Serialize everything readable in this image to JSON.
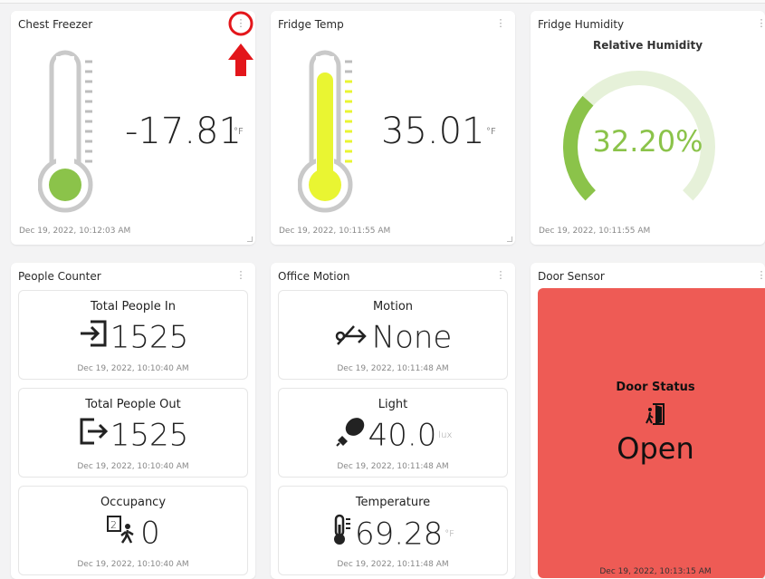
{
  "widgets": {
    "chest_freezer": {
      "title": "Chest Freezer",
      "value": "-17.81",
      "unit": "°F",
      "timestamp": "Dec 19, 2022, 10:12:03 AM",
      "level": 0.0,
      "color": "#8bc34a"
    },
    "fridge_temp": {
      "title": "Fridge Temp",
      "value": "35.01",
      "unit": "°F",
      "timestamp": "Dec 19, 2022, 10:11:55 AM",
      "level": 0.82,
      "color": "#e9f532"
    },
    "fridge_humidity": {
      "title": "Fridge Humidity",
      "label": "Relative Humidity",
      "value": "32.20%",
      "percent": 32.2,
      "timestamp": "Dec 19, 2022, 10:11:55 AM",
      "color": "#8bc34a",
      "track_color": "#e6f1d9"
    },
    "people_counter": {
      "title": "People Counter",
      "items": [
        {
          "label": "Total People In",
          "value": "1525",
          "icon": "login-arrow-icon",
          "timestamp": "Dec 19, 2022, 10:10:40 AM"
        },
        {
          "label": "Total People Out",
          "value": "1525",
          "icon": "logout-arrow-icon",
          "timestamp": "Dec 19, 2022, 10:10:40 AM"
        },
        {
          "label": "Occupancy",
          "value": "0",
          "icon": "occupancy-icon",
          "timestamp": "Dec 19, 2022, 10:10:40 AM"
        }
      ]
    },
    "office_motion": {
      "title": "Office Motion",
      "items": [
        {
          "label": "Motion",
          "value": "None",
          "icon": "motion-off-icon",
          "unit": "",
          "timestamp": "Dec 19, 2022, 10:11:48 AM"
        },
        {
          "label": "Light",
          "value": "40.0",
          "icon": "light-bulb-icon",
          "unit": "lux",
          "timestamp": "Dec 19, 2022, 10:11:48 AM"
        },
        {
          "label": "Temperature",
          "value": "69.28",
          "icon": "thermometer-icon",
          "unit": "°F",
          "timestamp": "Dec 19, 2022, 10:11:48 AM"
        }
      ]
    },
    "door_sensor": {
      "title": "Door Sensor",
      "label": "Door Status",
      "value": "Open",
      "icon": "door-open-icon",
      "timestamp": "Dec 19, 2022, 10:13:15 AM",
      "color": "#ee5b55"
    }
  },
  "annotation": {
    "color": "#e3161b"
  }
}
